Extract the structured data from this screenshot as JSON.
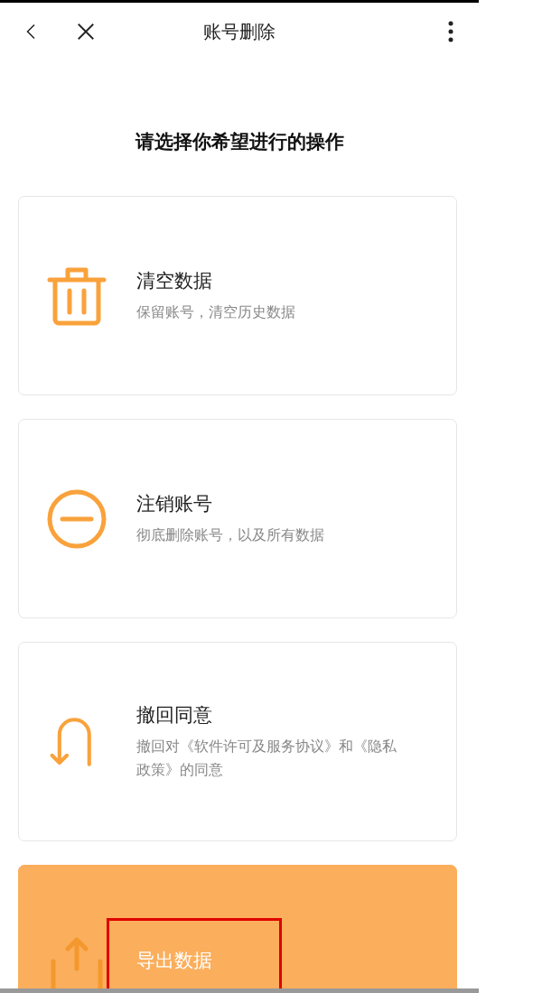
{
  "header": {
    "title": "账号删除"
  },
  "prompt": "请选择你希望进行的操作",
  "options": [
    {
      "kind": "trash",
      "title": "清空数据",
      "subtitle": "保留账号，清空历史数据",
      "selected": false,
      "highlighted": false
    },
    {
      "kind": "minus-circle",
      "title": "注销账号",
      "subtitle": "彻底删除账号，以及所有数据",
      "selected": false,
      "highlighted": false
    },
    {
      "kind": "u-turn",
      "title": "撤回同意",
      "subtitle": "撤回对《软件许可及服务协议》和《隐私政策》的同意",
      "selected": false,
      "highlighted": false
    },
    {
      "kind": "upload",
      "title": "导出数据",
      "selected": true,
      "highlighted": true
    }
  ]
}
